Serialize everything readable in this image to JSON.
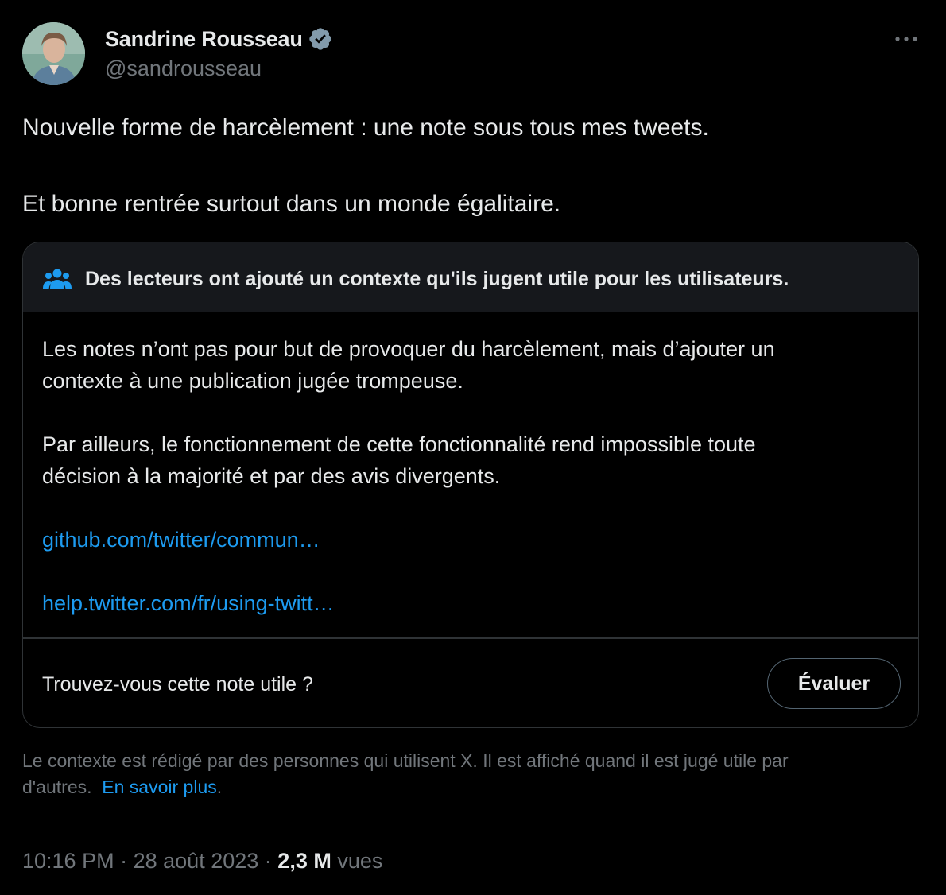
{
  "author": {
    "name": "Sandrine Rousseau",
    "handle": "@sandrousseau",
    "verified_icon": "verified-badge-icon"
  },
  "more_menu": {
    "label": "···"
  },
  "tweet": {
    "lines": [
      "Nouvelle forme de harcèlement : une note sous tous mes tweets.",
      "Et bonne rentrée surtout dans un monde égalitaire."
    ]
  },
  "note": {
    "header": "Des lecteurs ont ajouté un contexte qu'ils jugent utile pour les utilisateurs.",
    "header_icon": "people-icon",
    "body_lines": [
      "Les notes n’ont pas pour but de provoquer du harcèlement, mais d’ajouter un",
      "contexte à une publication jugée trompeuse.",
      "Par ailleurs, le fonctionnement de cette fonctionnalité rend impossible toute",
      "décision à la majorité et par des avis divergents."
    ],
    "links": [
      "github.com/twitter/commun…",
      "help.twitter.com/fr/using-twitt…"
    ],
    "question": "Trouvez-vous cette note utile ?",
    "rate_button": "Évaluer"
  },
  "disclaimer": {
    "line1": "Le contexte est rédigé par des personnes qui utilisent X. Il est affiché quand il est jugé utile par",
    "line2_prefix": "d'autres.",
    "learn_more": "En savoir plus",
    "line2_suffix": "."
  },
  "meta": {
    "time": "10:16 PM",
    "separator": "·",
    "date": "28 août 2023",
    "views_count": "2,3 M",
    "views_label": "vues"
  },
  "colors": {
    "background": "#000000",
    "text": "#e7e9ea",
    "secondary": "#71767b",
    "link": "#1d9bf0",
    "note_header_bg": "#16181c",
    "border": "#2f3336"
  }
}
